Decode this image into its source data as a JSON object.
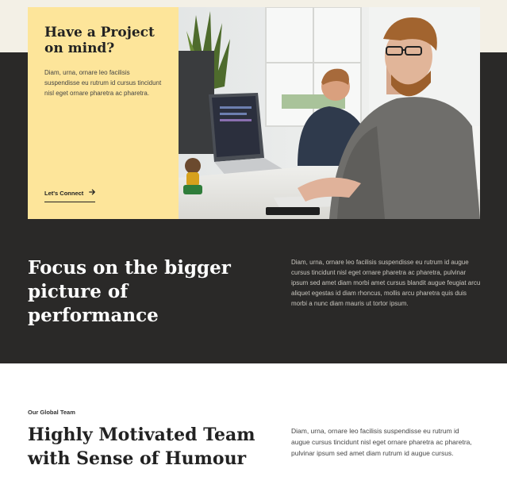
{
  "hero": {
    "card_title": "Have a Project on mind?",
    "card_text": "Diam, urna, ornare leo facilisis suspendisse eu rutrum id cursus tincidunt nisl eget ornare pharetra ac pharetra.",
    "cta_label": "Let's Connect",
    "cta_icon": "arrow-right-icon",
    "photo_subject": "office-workers-photo"
  },
  "focus": {
    "title": "Focus on the bigger picture of performance",
    "text": "Diam, urna, ornare leo facilisis suspendisse eu rutrum id augue cursus tincidunt nisl eget ornare pharetra ac pharetra, pulvinar ipsum sed amet diam morbi amet cursus blandit augue feugiat arcu aliquet egestas id diam rhoncus, mollis arcu pharetra quis duis morbi a nunc diam mauris ut tortor ipsum."
  },
  "team": {
    "eyebrow": "Our Global Team",
    "title": "Highly Motivated Team with Sense of Humour",
    "text": "Diam, urna, ornare leo facilisis suspendisse eu rutrum id augue cursus tincidunt nisl eget ornare pharetra ac pharetra, pulvinar ipsum sed amet diam rutrum id augue cursus."
  },
  "colors": {
    "cream": "#f3f0e6",
    "dark": "#2a2928",
    "yellow_card": "#fde59a",
    "white": "#ffffff"
  }
}
